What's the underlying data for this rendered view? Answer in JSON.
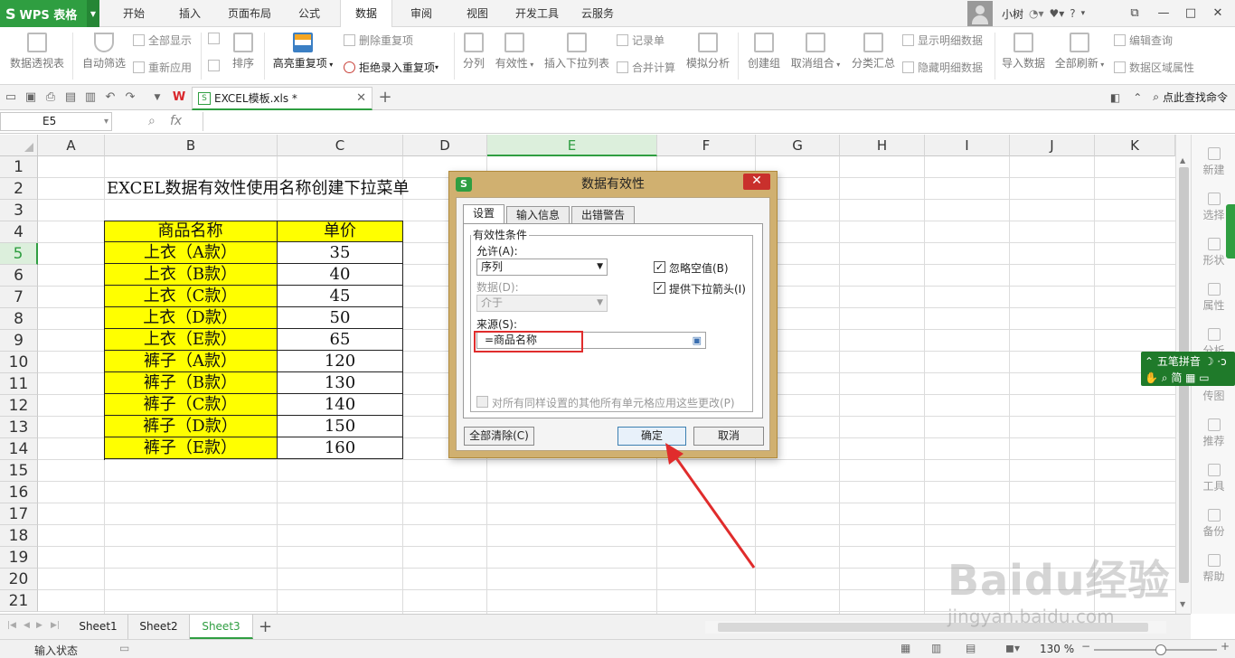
{
  "app": {
    "name": "WPS 表格",
    "logo": "S"
  },
  "menu": {
    "tabs": [
      "开始",
      "插入",
      "页面布局",
      "公式",
      "数据",
      "审阅",
      "视图",
      "开发工具",
      "云服务"
    ],
    "active": "数据"
  },
  "user": {
    "name": "小树"
  },
  "window_controls": {
    "minimize": "—",
    "maximize": "□",
    "help": "?"
  },
  "ribbon": {
    "pivot": "数据透视表",
    "autofilter": "自动筛选",
    "show_all": "全部显示",
    "reapply": "重新应用",
    "sort": "排序",
    "highlight_dup": "高亮重复项",
    "remove_dup": "删除重复项",
    "reject_dup": "拒绝录入重复项",
    "split": "分列",
    "validity": "有效性",
    "insert_dropdown": "插入下拉列表",
    "record_form": "记录单",
    "merge_calc": "合并计算",
    "simulate": "模拟分析",
    "group": "创建组",
    "ungroup": "取消组合",
    "subtotal": "分类汇总",
    "show_detail": "显示明细数据",
    "hide_detail": "隐藏明细数据",
    "import": "导入数据",
    "refresh_all": "全部刷新",
    "edit_query": "编辑查询",
    "range_props": "数据区域属性"
  },
  "doc_tab": {
    "filename": "EXCEL模板.xls *",
    "find_command": "点此查找命令"
  },
  "formula_bar": {
    "name_box": "E5",
    "fx": "fx"
  },
  "grid": {
    "columns": [
      "A",
      "B",
      "C",
      "D",
      "E",
      "F",
      "G",
      "H",
      "I",
      "J",
      "K"
    ],
    "selected_column": "E",
    "rows": [
      "1",
      "2",
      "3",
      "4",
      "5",
      "6",
      "7",
      "8",
      "9",
      "10",
      "11",
      "12",
      "13",
      "14",
      "15",
      "16",
      "17",
      "18",
      "19",
      "20",
      "21"
    ],
    "selected_row": "5",
    "title_cell": "EXCEL数据有效性使用名称创建下拉菜单",
    "table": {
      "headers": [
        "商品名称",
        "单价"
      ],
      "rows": [
        [
          "上衣（A款）",
          "35"
        ],
        [
          "上衣（B款）",
          "40"
        ],
        [
          "上衣（C款）",
          "45"
        ],
        [
          "上衣（D款）",
          "50"
        ],
        [
          "上衣（E款）",
          "65"
        ],
        [
          "裤子（A款）",
          "120"
        ],
        [
          "裤子（B款）",
          "130"
        ],
        [
          "裤子（C款）",
          "140"
        ],
        [
          "裤子（D款）",
          "150"
        ],
        [
          "裤子（E款）",
          "160"
        ]
      ]
    },
    "highlight_color": "#ffff00"
  },
  "dialog": {
    "title": "数据有效性",
    "tabs": [
      "设置",
      "输入信息",
      "出错警告"
    ],
    "active_tab": "设置",
    "group_title": "有效性条件",
    "allow_label": "允许(A):",
    "allow_value": "序列",
    "data_label": "数据(D):",
    "data_value": "介于",
    "ignore_blank": "忽略空值(B)",
    "dropdown_arrow": "提供下拉箭头(I)",
    "source_label": "来源(S):",
    "source_value": "=商品名称",
    "apply_all": "对所有同样设置的其他所有单元格应用这些更改(P)",
    "clear_all": "全部清除(C)",
    "ok": "确定",
    "cancel": "取消"
  },
  "side_panel": {
    "items": [
      "新建",
      "选择",
      "形状",
      "属性",
      "分析",
      "传图",
      "推荐",
      "工具",
      "备份",
      "帮助"
    ]
  },
  "ime": {
    "line1": "五笔拼音",
    "line2": "简"
  },
  "sheets": {
    "tabs": [
      "Sheet1",
      "Sheet2",
      "Sheet3"
    ],
    "active": "Sheet3"
  },
  "status": {
    "mode": "输入状态",
    "zoom": "130 %"
  },
  "watermark": {
    "text": "Baidu经验",
    "url": "jingyan.baidu.com"
  },
  "accent_color": "#2f9e41",
  "annotation_color": "#e02c2c"
}
